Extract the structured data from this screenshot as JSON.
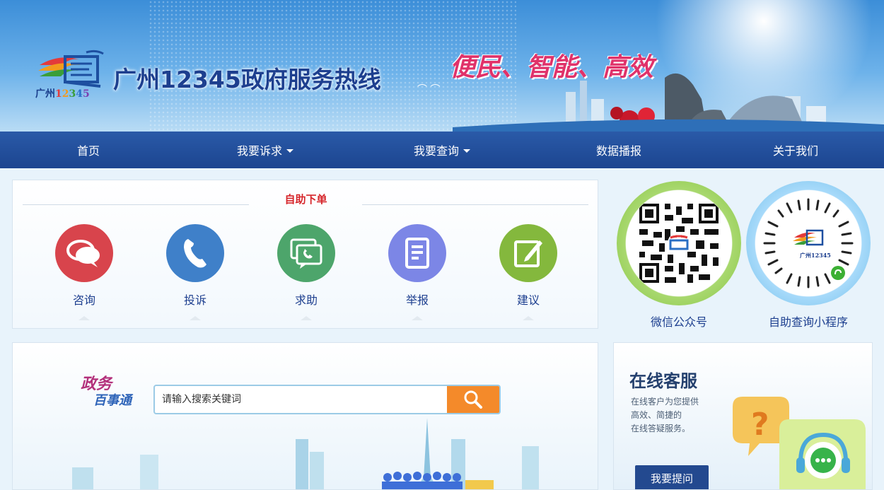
{
  "header": {
    "site_title": "广州12345政府服务热线",
    "logo_sub": {
      "prefix": "广州",
      "digits": [
        "1",
        "2",
        "3",
        "4",
        "5"
      ]
    },
    "slogan": "便民、智能、高效"
  },
  "nav": {
    "items": [
      {
        "label": "首页",
        "dropdown": false
      },
      {
        "label": "我要诉求",
        "dropdown": true
      },
      {
        "label": "我要查询",
        "dropdown": true
      },
      {
        "label": "数据播报",
        "dropdown": false
      },
      {
        "label": "关于我们",
        "dropdown": false
      }
    ]
  },
  "self_service": {
    "title": "自助下单",
    "services": [
      {
        "label": "咨询",
        "icon": "chat-bubbles-icon",
        "color": "#d8444c"
      },
      {
        "label": "投诉",
        "icon": "phone-icon",
        "color": "#3f80c9"
      },
      {
        "label": "求助",
        "icon": "help-chat-icon",
        "color": "#4da56b"
      },
      {
        "label": "举报",
        "icon": "document-icon",
        "color": "#7c86e6"
      },
      {
        "label": "建议",
        "icon": "edit-icon",
        "color": "#84b83d"
      }
    ]
  },
  "qr_codes": [
    {
      "label": "微信公众号",
      "ring_color": "#8fcf4f"
    },
    {
      "label": "自助查询小程序",
      "ring_color": "#7cc4ee"
    }
  ],
  "search": {
    "logo_line1": "政务",
    "logo_line2": "百事通",
    "placeholder": "请输入搜索关键词",
    "button_color": "#f48a2a"
  },
  "online_service": {
    "title": "在线客服",
    "desc_lines": [
      "在线客户为您提供",
      "高效、简捷的",
      "在线答疑服务。"
    ],
    "button_label": "我要提问"
  },
  "colors": {
    "nav_bg": "#1c4590",
    "accent_red": "#d6262b",
    "text_blue": "#1d3f8f"
  }
}
